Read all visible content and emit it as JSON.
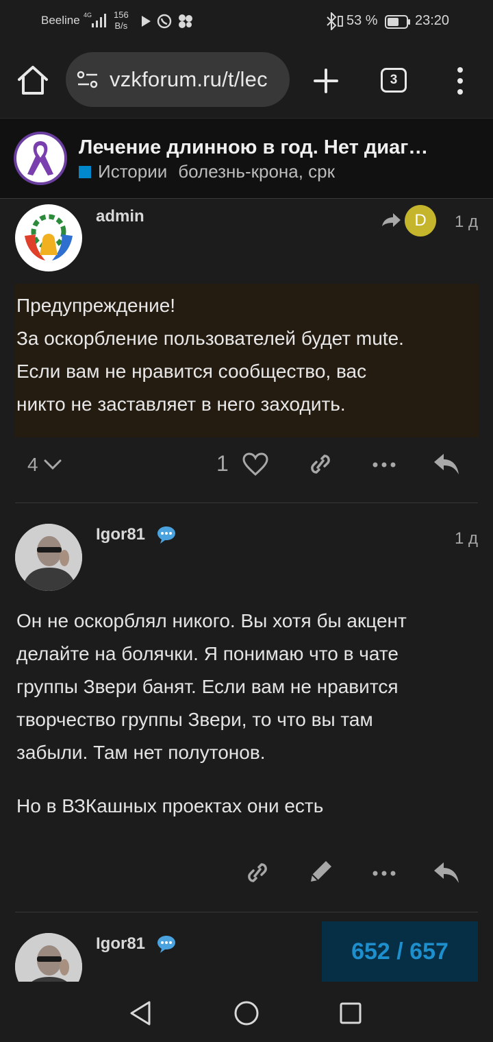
{
  "status_bar": {
    "carrier": "Beeline",
    "network": "4G",
    "speed_value": "156",
    "speed_unit": "B/s",
    "battery": "53 %",
    "time": "23:20"
  },
  "browser": {
    "url": "vzkforum.ru/t/lec",
    "tab_count": "3"
  },
  "topic": {
    "title": "Лечение длинною в год. Нет диаг…",
    "category": "Истории",
    "tags": "болезнь-крона, срк",
    "category_color": "#0088cc"
  },
  "posts": [
    {
      "username": "admin",
      "reply_avatar_letter": "D",
      "date": "1 д",
      "lines": [
        "Предупреждение!",
        "За оскорбление пользователей будет mute.",
        "Если вам не нравится сообщество, вас",
        "никто не заставляет в него заходить."
      ],
      "replies_count": "4",
      "likes_count": "1"
    },
    {
      "username": "Igor81",
      "date": "1 д",
      "lines": [
        "Он не оскорблял никого. Вы хотя бы акцент",
        "делайте на болячки. Я понимаю что в чате",
        "группы Звери банят. Если вам не нравится",
        "творчество группы Звери, то что вы там",
        "забыли. Там нет полутонов."
      ],
      "paragraph2": "Но в ВЗКашных проектах они есть"
    },
    {
      "username": "Igor81"
    }
  ],
  "progress": "652 / 657"
}
